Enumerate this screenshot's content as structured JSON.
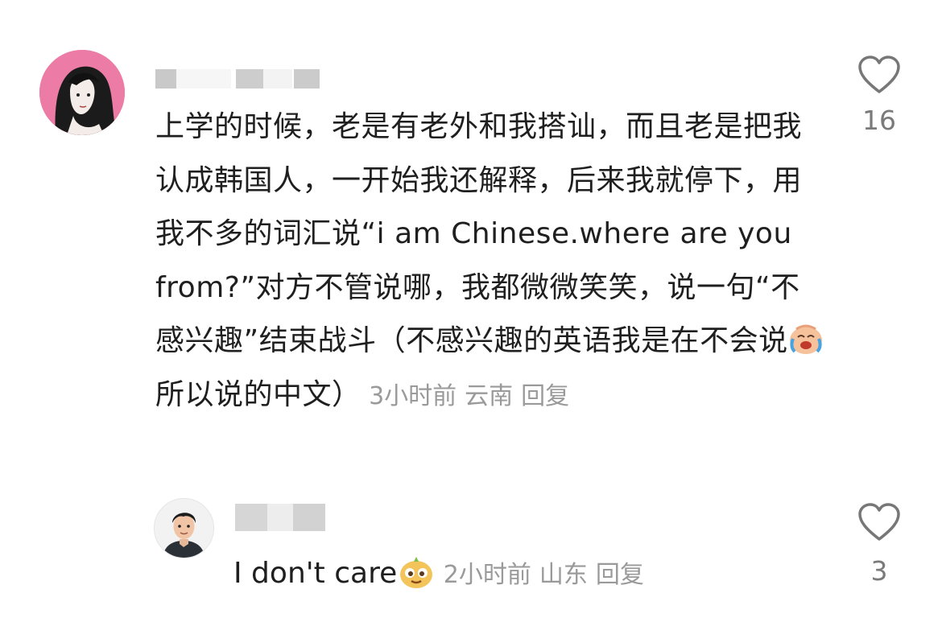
{
  "comments": [
    {
      "author_name": "",
      "text": "上学的时候，老是有老外和我搭讪，而且老是把我认成韩国人，一开始我还解释，后来我就停下，用我不多的词汇说“i am Chinese.where are you from?”对方不管说哪，我都微微笑笑，说一句“不感兴趣”结束战斗（不感兴趣的英语我是在不会说",
      "text_after_emoji": "所以说的中文）",
      "emoji": "crying-laughing-emoji",
      "time": "3小时前",
      "location": "云南",
      "reply_label": "回复",
      "likes": "16"
    }
  ],
  "replies": [
    {
      "author_name": "",
      "text": "I don't care",
      "emoji": "mischievous-face-emoji",
      "time": "2小时前",
      "location": "山东",
      "reply_label": "回复",
      "likes": "3"
    }
  ],
  "icons": {
    "like": "heart-outline-icon"
  },
  "colors": {
    "text": "#1f1f1f",
    "meta": "#9a9a9a",
    "like_count": "#7a7a7a",
    "avatar_bg": "#ec7ba5"
  }
}
